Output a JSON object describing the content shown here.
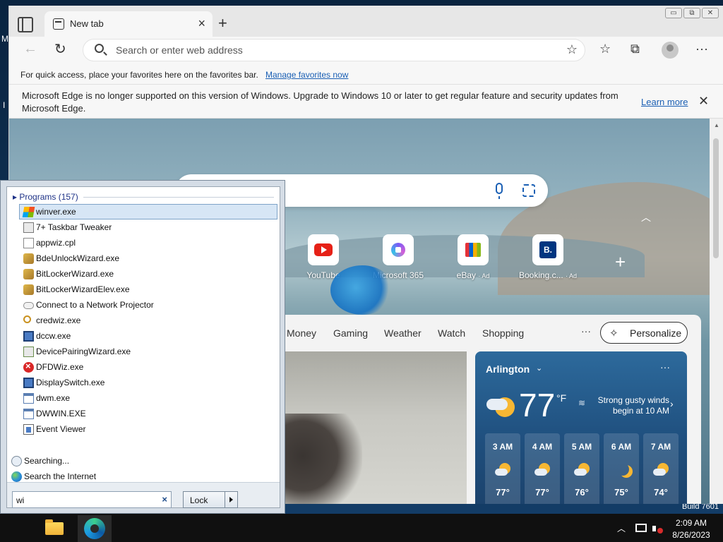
{
  "desktop": {
    "label_m": "M",
    "label_i": "I"
  },
  "browser": {
    "tab": {
      "title": "New tab"
    },
    "window_controls": {
      "minimize": "▭",
      "restore": "⧉",
      "close": "✕"
    },
    "address_bar": {
      "placeholder": "Search or enter web address",
      "value": ""
    },
    "favorites_bar": {
      "text": "For quick access, place your favorites here on the favorites bar.",
      "link": "Manage favorites now"
    },
    "info_bar": {
      "message": "Microsoft Edge is no longer supported on this version of Windows. Upgrade to Windows 10 or later to get regular feature and security updates from Microsoft Edge.",
      "learn_more": "Learn more"
    },
    "quick_links": [
      {
        "label": "YouTube",
        "ad": ""
      },
      {
        "label": "Microsoft 365",
        "ad": ""
      },
      {
        "label": "eBay",
        "ad": "· Ad"
      },
      {
        "label": "Booking.c...",
        "ad": "· Ad"
      }
    ],
    "feed_tabs": [
      "Money",
      "Gaming",
      "Weather",
      "Watch",
      "Shopping"
    ],
    "feed_more": "···",
    "personalize": "Personalize",
    "weather": {
      "city": "Arlington",
      "temp": "77",
      "unit": "°F",
      "alert": "Strong gusty winds begin at 10 AM",
      "more": "···",
      "hourly": [
        {
          "time": "3 AM",
          "temp": "77°",
          "icon": "partly-cloudy-night"
        },
        {
          "time": "4 AM",
          "temp": "77°",
          "icon": "partly-cloudy-night"
        },
        {
          "time": "5 AM",
          "temp": "76°",
          "icon": "partly-cloudy-night"
        },
        {
          "time": "6 AM",
          "temp": "75°",
          "icon": "moon"
        },
        {
          "time": "7 AM",
          "temp": "74°",
          "icon": "partly-cloudy-day"
        }
      ]
    }
  },
  "start_menu": {
    "programs_header": "Programs (157)",
    "results": [
      {
        "label": "winver.exe",
        "icon": "windows-flag-icon",
        "selected": true
      },
      {
        "label": "7+ Taskbar Tweaker",
        "icon": "tool-icon"
      },
      {
        "label": "appwiz.cpl",
        "icon": "control-panel-icon"
      },
      {
        "label": "BdeUnlockWizard.exe",
        "icon": "keys-icon"
      },
      {
        "label": "BitLockerWizard.exe",
        "icon": "keys-icon"
      },
      {
        "label": "BitLockerWizardElev.exe",
        "icon": "keys-icon"
      },
      {
        "label": "Connect to a Network Projector",
        "icon": "projector-icon"
      },
      {
        "label": "credwiz.exe",
        "icon": "magnifier-key-icon"
      },
      {
        "label": "dccw.exe",
        "icon": "monitor-icon"
      },
      {
        "label": "DevicePairingWizard.exe",
        "icon": "device-icon"
      },
      {
        "label": "DFDWiz.exe",
        "icon": "error-icon"
      },
      {
        "label": "DisplaySwitch.exe",
        "icon": "monitor-icon"
      },
      {
        "label": "dwm.exe",
        "icon": "window-icon"
      },
      {
        "label": "DWWIN.EXE",
        "icon": "window-icon"
      },
      {
        "label": "Event Viewer",
        "icon": "event-viewer-icon"
      }
    ],
    "searching": "Searching...",
    "search_internet": "Search the Internet",
    "search_input": {
      "value": "wi"
    },
    "lock_button": "Lock"
  },
  "taskbar": {
    "time": "2:09 AM",
    "date": "8/26/2023",
    "build": "Build 7601"
  }
}
